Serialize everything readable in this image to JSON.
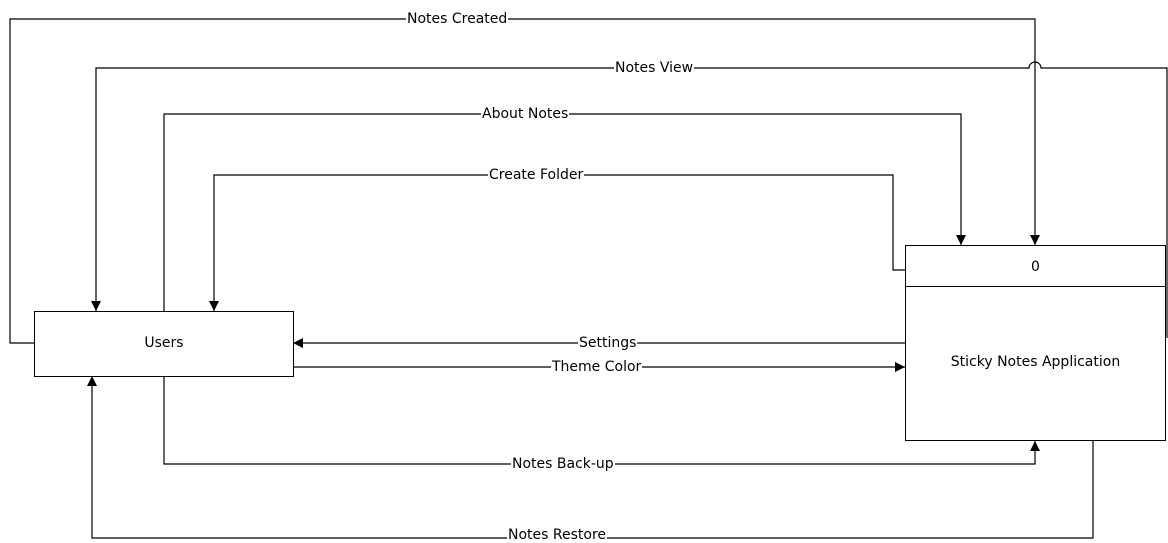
{
  "entities": {
    "users": "Users",
    "process_number": "0",
    "process_name": "Sticky Notes Application"
  },
  "flows": {
    "notes_created": "Notes Created",
    "notes_view": "Notes View",
    "about_notes": "About Notes",
    "create_folder": "Create Folder",
    "settings": "Settings",
    "theme_color": "Theme Color",
    "notes_backup": "Notes Back-up",
    "notes_restore": "Notes Restore"
  }
}
